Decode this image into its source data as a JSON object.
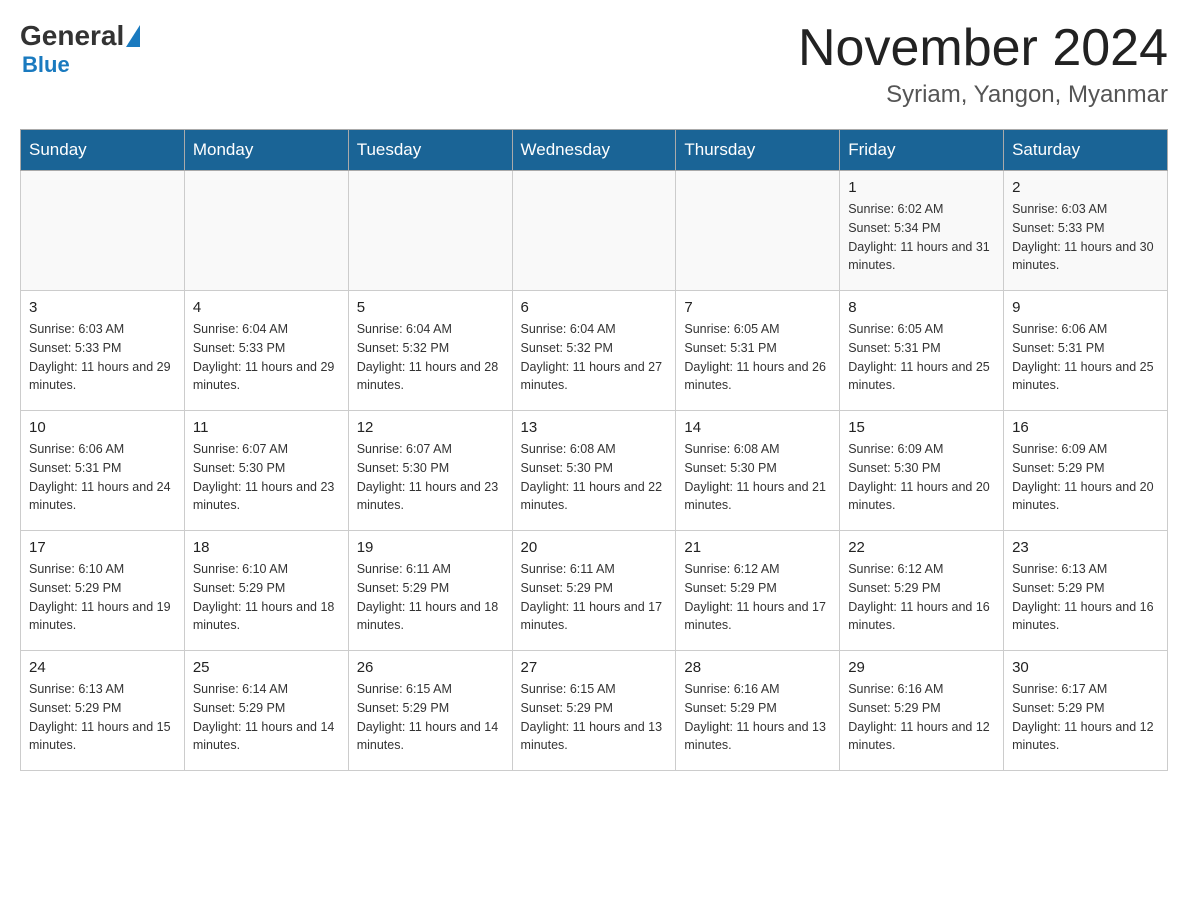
{
  "header": {
    "logo_general": "General",
    "logo_blue": "Blue",
    "month_title": "November 2024",
    "location": "Syriam, Yangon, Myanmar"
  },
  "weekdays": [
    "Sunday",
    "Monday",
    "Tuesday",
    "Wednesday",
    "Thursday",
    "Friday",
    "Saturday"
  ],
  "weeks": [
    [
      {
        "day": "",
        "info": ""
      },
      {
        "day": "",
        "info": ""
      },
      {
        "day": "",
        "info": ""
      },
      {
        "day": "",
        "info": ""
      },
      {
        "day": "",
        "info": ""
      },
      {
        "day": "1",
        "info": "Sunrise: 6:02 AM\nSunset: 5:34 PM\nDaylight: 11 hours and 31 minutes."
      },
      {
        "day": "2",
        "info": "Sunrise: 6:03 AM\nSunset: 5:33 PM\nDaylight: 11 hours and 30 minutes."
      }
    ],
    [
      {
        "day": "3",
        "info": "Sunrise: 6:03 AM\nSunset: 5:33 PM\nDaylight: 11 hours and 29 minutes."
      },
      {
        "day": "4",
        "info": "Sunrise: 6:04 AM\nSunset: 5:33 PM\nDaylight: 11 hours and 29 minutes."
      },
      {
        "day": "5",
        "info": "Sunrise: 6:04 AM\nSunset: 5:32 PM\nDaylight: 11 hours and 28 minutes."
      },
      {
        "day": "6",
        "info": "Sunrise: 6:04 AM\nSunset: 5:32 PM\nDaylight: 11 hours and 27 minutes."
      },
      {
        "day": "7",
        "info": "Sunrise: 6:05 AM\nSunset: 5:31 PM\nDaylight: 11 hours and 26 minutes."
      },
      {
        "day": "8",
        "info": "Sunrise: 6:05 AM\nSunset: 5:31 PM\nDaylight: 11 hours and 25 minutes."
      },
      {
        "day": "9",
        "info": "Sunrise: 6:06 AM\nSunset: 5:31 PM\nDaylight: 11 hours and 25 minutes."
      }
    ],
    [
      {
        "day": "10",
        "info": "Sunrise: 6:06 AM\nSunset: 5:31 PM\nDaylight: 11 hours and 24 minutes."
      },
      {
        "day": "11",
        "info": "Sunrise: 6:07 AM\nSunset: 5:30 PM\nDaylight: 11 hours and 23 minutes."
      },
      {
        "day": "12",
        "info": "Sunrise: 6:07 AM\nSunset: 5:30 PM\nDaylight: 11 hours and 23 minutes."
      },
      {
        "day": "13",
        "info": "Sunrise: 6:08 AM\nSunset: 5:30 PM\nDaylight: 11 hours and 22 minutes."
      },
      {
        "day": "14",
        "info": "Sunrise: 6:08 AM\nSunset: 5:30 PM\nDaylight: 11 hours and 21 minutes."
      },
      {
        "day": "15",
        "info": "Sunrise: 6:09 AM\nSunset: 5:30 PM\nDaylight: 11 hours and 20 minutes."
      },
      {
        "day": "16",
        "info": "Sunrise: 6:09 AM\nSunset: 5:29 PM\nDaylight: 11 hours and 20 minutes."
      }
    ],
    [
      {
        "day": "17",
        "info": "Sunrise: 6:10 AM\nSunset: 5:29 PM\nDaylight: 11 hours and 19 minutes."
      },
      {
        "day": "18",
        "info": "Sunrise: 6:10 AM\nSunset: 5:29 PM\nDaylight: 11 hours and 18 minutes."
      },
      {
        "day": "19",
        "info": "Sunrise: 6:11 AM\nSunset: 5:29 PM\nDaylight: 11 hours and 18 minutes."
      },
      {
        "day": "20",
        "info": "Sunrise: 6:11 AM\nSunset: 5:29 PM\nDaylight: 11 hours and 17 minutes."
      },
      {
        "day": "21",
        "info": "Sunrise: 6:12 AM\nSunset: 5:29 PM\nDaylight: 11 hours and 17 minutes."
      },
      {
        "day": "22",
        "info": "Sunrise: 6:12 AM\nSunset: 5:29 PM\nDaylight: 11 hours and 16 minutes."
      },
      {
        "day": "23",
        "info": "Sunrise: 6:13 AM\nSunset: 5:29 PM\nDaylight: 11 hours and 16 minutes."
      }
    ],
    [
      {
        "day": "24",
        "info": "Sunrise: 6:13 AM\nSunset: 5:29 PM\nDaylight: 11 hours and 15 minutes."
      },
      {
        "day": "25",
        "info": "Sunrise: 6:14 AM\nSunset: 5:29 PM\nDaylight: 11 hours and 14 minutes."
      },
      {
        "day": "26",
        "info": "Sunrise: 6:15 AM\nSunset: 5:29 PM\nDaylight: 11 hours and 14 minutes."
      },
      {
        "day": "27",
        "info": "Sunrise: 6:15 AM\nSunset: 5:29 PM\nDaylight: 11 hours and 13 minutes."
      },
      {
        "day": "28",
        "info": "Sunrise: 6:16 AM\nSunset: 5:29 PM\nDaylight: 11 hours and 13 minutes."
      },
      {
        "day": "29",
        "info": "Sunrise: 6:16 AM\nSunset: 5:29 PM\nDaylight: 11 hours and 12 minutes."
      },
      {
        "day": "30",
        "info": "Sunrise: 6:17 AM\nSunset: 5:29 PM\nDaylight: 11 hours and 12 minutes."
      }
    ]
  ]
}
